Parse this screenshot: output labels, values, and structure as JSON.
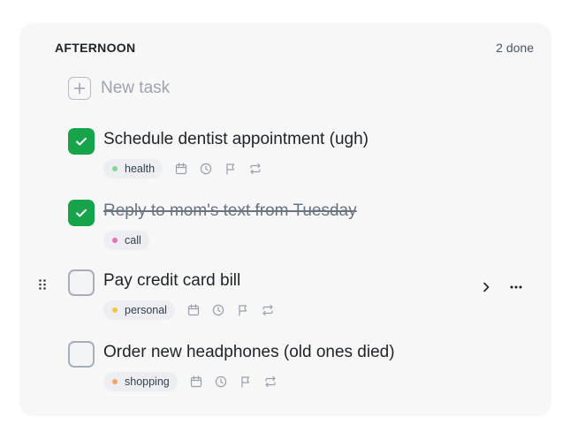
{
  "section": {
    "title": "AFTERNOON",
    "done_count": "2 done"
  },
  "new_task": {
    "label": "New task"
  },
  "tasks": [
    {
      "title": "Schedule dentist appointment (ugh)",
      "completed": true,
      "tag": {
        "label": "health",
        "color": "#86d49c"
      },
      "show_action_icons": true
    },
    {
      "title": "Reply to mom's text from Tuesday",
      "completed": true,
      "tag": {
        "label": "call",
        "color": "#ec6fb3"
      },
      "show_action_icons": false
    },
    {
      "title": "Pay credit card bill",
      "completed": false,
      "tag": {
        "label": "personal",
        "color": "#f5c542"
      },
      "show_action_icons": true,
      "hovered": true
    },
    {
      "title": "Order new headphones (old ones died)",
      "completed": false,
      "tag": {
        "label": "shopping",
        "color": "#f5a36b"
      },
      "show_action_icons": true
    }
  ],
  "icons": {
    "plus": "plus-icon",
    "check": "check-icon",
    "calendar": "calendar-icon",
    "clock": "clock-icon",
    "flag": "flag-icon",
    "repeat": "repeat-icon",
    "drag": "drag-handle-icon",
    "expand": "chevron-right-icon",
    "more": "more-horizontal-icon"
  },
  "colors": {
    "card_bg": "#f7f7f8",
    "check_green": "#16a34a",
    "text_primary": "#1f2328",
    "text_muted": "#9ca3af"
  }
}
